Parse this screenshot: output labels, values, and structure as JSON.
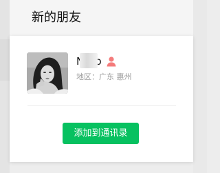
{
  "header": {
    "title": "新的朋友"
  },
  "profile": {
    "nickname": "N...o",
    "gender_icon": "female-person-icon",
    "region": "地区：广东 惠州"
  },
  "actions": {
    "add_to_contacts_label": "添加到通讯录"
  },
  "colors": {
    "accent_green": "#07c160",
    "gender_icon": "#f47b7b",
    "secondary_text": "#9b9b9b"
  }
}
